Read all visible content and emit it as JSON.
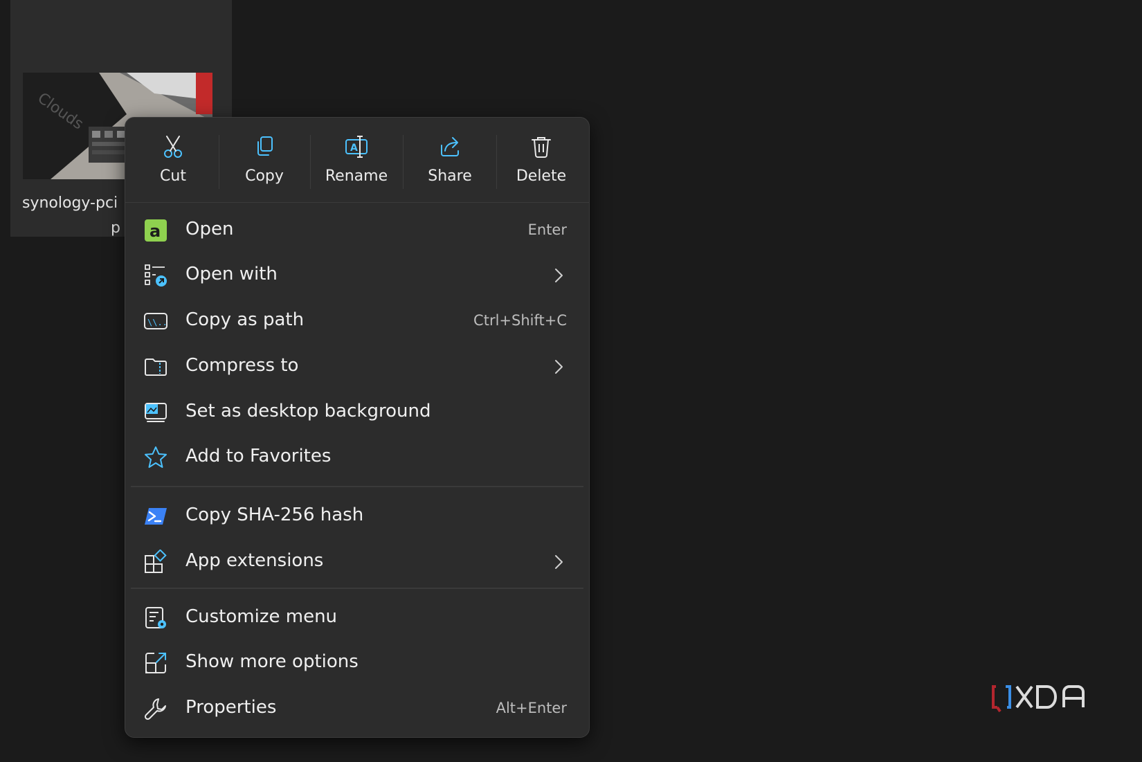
{
  "file": {
    "name_line1": "synology-pci",
    "name_line2": "p"
  },
  "toolbar": {
    "cut": "Cut",
    "copy": "Copy",
    "rename": "Rename",
    "share": "Share",
    "delete": "Delete"
  },
  "menu": {
    "open": {
      "label": "Open",
      "shortcut": "Enter"
    },
    "open_with": {
      "label": "Open with"
    },
    "copy_as_path": {
      "label": "Copy as path",
      "shortcut": "Ctrl+Shift+C"
    },
    "compress_to": {
      "label": "Compress to"
    },
    "set_desktop_bg": {
      "label": "Set as desktop background"
    },
    "add_favorites": {
      "label": "Add to Favorites"
    },
    "copy_sha256": {
      "label": "Copy SHA-256 hash"
    },
    "app_extensions": {
      "label": "App extensions"
    },
    "customize_menu": {
      "label": "Customize menu"
    },
    "show_more": {
      "label": "Show more options"
    },
    "properties": {
      "label": "Properties",
      "shortcut": "Alt+Enter"
    }
  },
  "colors": {
    "background": "#1b1b1b",
    "menu": "#2c2c2c",
    "accent_blue": "#4cc2ff",
    "open_app_green": "#8fd14f"
  }
}
